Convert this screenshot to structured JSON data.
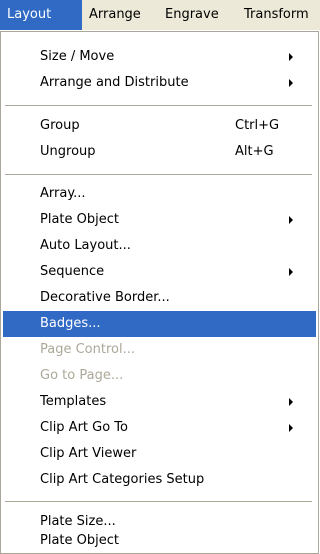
{
  "menubar": {
    "items": [
      "Layout",
      "Arrange",
      "Engrave",
      "Transform"
    ],
    "active": "Layout"
  },
  "menu": {
    "sections": [
      [
        {
          "label": "Size / Move",
          "submenu": true
        },
        {
          "label": "Arrange and Distribute",
          "submenu": true
        }
      ],
      [
        {
          "label": "Group",
          "shortcut": "Ctrl+G"
        },
        {
          "label": "Ungroup",
          "shortcut": "Alt+G"
        }
      ],
      [
        {
          "label": "Array..."
        },
        {
          "label": "Plate Object",
          "submenu": true
        },
        {
          "label": "Auto Layout..."
        },
        {
          "label": "Sequence",
          "submenu": true
        },
        {
          "label": "Decorative Border..."
        },
        {
          "label": "Badges...",
          "highlighted": true
        },
        {
          "label": "Page Control...",
          "disabled": true
        },
        {
          "label": "Go to Page...",
          "disabled": true
        },
        {
          "label": "Templates",
          "submenu": true
        },
        {
          "label": "Clip Art Go To",
          "submenu": true
        },
        {
          "label": "Clip Art Viewer"
        },
        {
          "label": "Clip Art Categories Setup"
        }
      ],
      [
        {
          "label": "Plate Size..."
        },
        {
          "label": "Plate Object"
        }
      ]
    ]
  },
  "colors": {
    "highlight": "#316ac5",
    "disabled_text": "#aca899",
    "menubar_bg": "#ece9d8"
  },
  "icons": {
    "submenu": "submenu-arrow-icon"
  }
}
